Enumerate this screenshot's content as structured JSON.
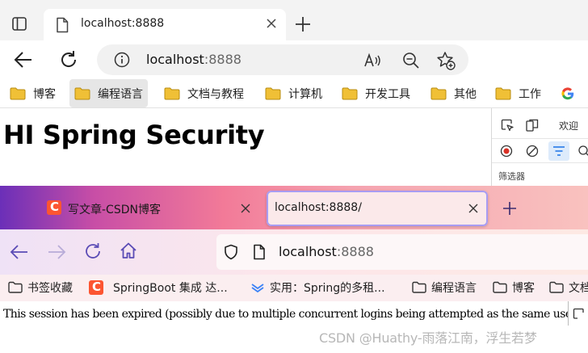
{
  "browser1": {
    "tab": {
      "title": "localhost:8888"
    },
    "address": {
      "host": "localhost",
      "port": ":8888"
    },
    "bookmarks": [
      "博客",
      "编程语言",
      "文档与教程",
      "计算机",
      "开发工具",
      "其他",
      "工作"
    ],
    "page": {
      "heading": "HI Spring Security"
    },
    "devtools": {
      "welcome_tab": "欢迎",
      "filter_label": "筛选器"
    }
  },
  "browser2": {
    "tabs": [
      {
        "title": "写文章-CSDN博客",
        "icon": "csdn-icon"
      },
      {
        "title": "localhost:8888/"
      }
    ],
    "address": {
      "host": "localhost",
      "port": ":8888"
    },
    "bookmarks": [
      {
        "label": "书签收藏",
        "icon": "folder-icon"
      },
      {
        "label": "SpringBoot 集成 达...",
        "icon": "csdn-icon"
      },
      {
        "label": "实用：Spring的多租...",
        "icon": "link-icon"
      },
      {
        "label": "编程语言",
        "icon": "folder-icon"
      },
      {
        "label": "博客",
        "icon": "folder-icon"
      },
      {
        "label": "文档",
        "icon": "folder-icon"
      }
    ],
    "page": {
      "message": "This session has been expired (possibly due to multiple concurrent logins being attempted as the same user)."
    }
  },
  "watermark": "CSDN @Huathy-雨落江南，浮生若梦",
  "colors": {
    "csdn_red": "#fc5531",
    "folder_yellow": "#f0c036",
    "tab_highlight": "#a89cf2"
  }
}
